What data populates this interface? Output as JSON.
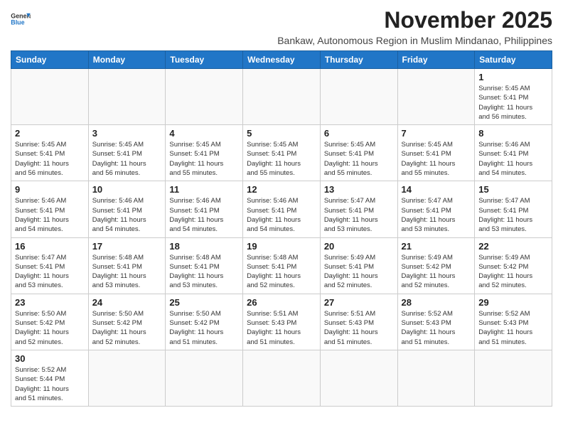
{
  "header": {
    "logo_line1": "General",
    "logo_line2": "Blue",
    "month": "November 2025",
    "subtitle": "Bankaw, Autonomous Region in Muslim Mindanao, Philippines"
  },
  "weekdays": [
    "Sunday",
    "Monday",
    "Tuesday",
    "Wednesday",
    "Thursday",
    "Friday",
    "Saturday"
  ],
  "weeks": [
    [
      {
        "day": "",
        "info": ""
      },
      {
        "day": "",
        "info": ""
      },
      {
        "day": "",
        "info": ""
      },
      {
        "day": "",
        "info": ""
      },
      {
        "day": "",
        "info": ""
      },
      {
        "day": "",
        "info": ""
      },
      {
        "day": "1",
        "info": "Sunrise: 5:45 AM\nSunset: 5:41 PM\nDaylight: 11 hours\nand 56 minutes."
      }
    ],
    [
      {
        "day": "2",
        "info": "Sunrise: 5:45 AM\nSunset: 5:41 PM\nDaylight: 11 hours\nand 56 minutes."
      },
      {
        "day": "3",
        "info": "Sunrise: 5:45 AM\nSunset: 5:41 PM\nDaylight: 11 hours\nand 56 minutes."
      },
      {
        "day": "4",
        "info": "Sunrise: 5:45 AM\nSunset: 5:41 PM\nDaylight: 11 hours\nand 55 minutes."
      },
      {
        "day": "5",
        "info": "Sunrise: 5:45 AM\nSunset: 5:41 PM\nDaylight: 11 hours\nand 55 minutes."
      },
      {
        "day": "6",
        "info": "Sunrise: 5:45 AM\nSunset: 5:41 PM\nDaylight: 11 hours\nand 55 minutes."
      },
      {
        "day": "7",
        "info": "Sunrise: 5:45 AM\nSunset: 5:41 PM\nDaylight: 11 hours\nand 55 minutes."
      },
      {
        "day": "8",
        "info": "Sunrise: 5:46 AM\nSunset: 5:41 PM\nDaylight: 11 hours\nand 54 minutes."
      }
    ],
    [
      {
        "day": "9",
        "info": "Sunrise: 5:46 AM\nSunset: 5:41 PM\nDaylight: 11 hours\nand 54 minutes."
      },
      {
        "day": "10",
        "info": "Sunrise: 5:46 AM\nSunset: 5:41 PM\nDaylight: 11 hours\nand 54 minutes."
      },
      {
        "day": "11",
        "info": "Sunrise: 5:46 AM\nSunset: 5:41 PM\nDaylight: 11 hours\nand 54 minutes."
      },
      {
        "day": "12",
        "info": "Sunrise: 5:46 AM\nSunset: 5:41 PM\nDaylight: 11 hours\nand 54 minutes."
      },
      {
        "day": "13",
        "info": "Sunrise: 5:47 AM\nSunset: 5:41 PM\nDaylight: 11 hours\nand 53 minutes."
      },
      {
        "day": "14",
        "info": "Sunrise: 5:47 AM\nSunset: 5:41 PM\nDaylight: 11 hours\nand 53 minutes."
      },
      {
        "day": "15",
        "info": "Sunrise: 5:47 AM\nSunset: 5:41 PM\nDaylight: 11 hours\nand 53 minutes."
      }
    ],
    [
      {
        "day": "16",
        "info": "Sunrise: 5:47 AM\nSunset: 5:41 PM\nDaylight: 11 hours\nand 53 minutes."
      },
      {
        "day": "17",
        "info": "Sunrise: 5:48 AM\nSunset: 5:41 PM\nDaylight: 11 hours\nand 53 minutes."
      },
      {
        "day": "18",
        "info": "Sunrise: 5:48 AM\nSunset: 5:41 PM\nDaylight: 11 hours\nand 53 minutes."
      },
      {
        "day": "19",
        "info": "Sunrise: 5:48 AM\nSunset: 5:41 PM\nDaylight: 11 hours\nand 52 minutes."
      },
      {
        "day": "20",
        "info": "Sunrise: 5:49 AM\nSunset: 5:41 PM\nDaylight: 11 hours\nand 52 minutes."
      },
      {
        "day": "21",
        "info": "Sunrise: 5:49 AM\nSunset: 5:42 PM\nDaylight: 11 hours\nand 52 minutes."
      },
      {
        "day": "22",
        "info": "Sunrise: 5:49 AM\nSunset: 5:42 PM\nDaylight: 11 hours\nand 52 minutes."
      }
    ],
    [
      {
        "day": "23",
        "info": "Sunrise: 5:50 AM\nSunset: 5:42 PM\nDaylight: 11 hours\nand 52 minutes."
      },
      {
        "day": "24",
        "info": "Sunrise: 5:50 AM\nSunset: 5:42 PM\nDaylight: 11 hours\nand 52 minutes."
      },
      {
        "day": "25",
        "info": "Sunrise: 5:50 AM\nSunset: 5:42 PM\nDaylight: 11 hours\nand 51 minutes."
      },
      {
        "day": "26",
        "info": "Sunrise: 5:51 AM\nSunset: 5:43 PM\nDaylight: 11 hours\nand 51 minutes."
      },
      {
        "day": "27",
        "info": "Sunrise: 5:51 AM\nSunset: 5:43 PM\nDaylight: 11 hours\nand 51 minutes."
      },
      {
        "day": "28",
        "info": "Sunrise: 5:52 AM\nSunset: 5:43 PM\nDaylight: 11 hours\nand 51 minutes."
      },
      {
        "day": "29",
        "info": "Sunrise: 5:52 AM\nSunset: 5:43 PM\nDaylight: 11 hours\nand 51 minutes."
      }
    ],
    [
      {
        "day": "30",
        "info": "Sunrise: 5:52 AM\nSunset: 5:44 PM\nDaylight: 11 hours\nand 51 minutes."
      },
      {
        "day": "",
        "info": ""
      },
      {
        "day": "",
        "info": ""
      },
      {
        "day": "",
        "info": ""
      },
      {
        "day": "",
        "info": ""
      },
      {
        "day": "",
        "info": ""
      },
      {
        "day": "",
        "info": ""
      }
    ]
  ]
}
